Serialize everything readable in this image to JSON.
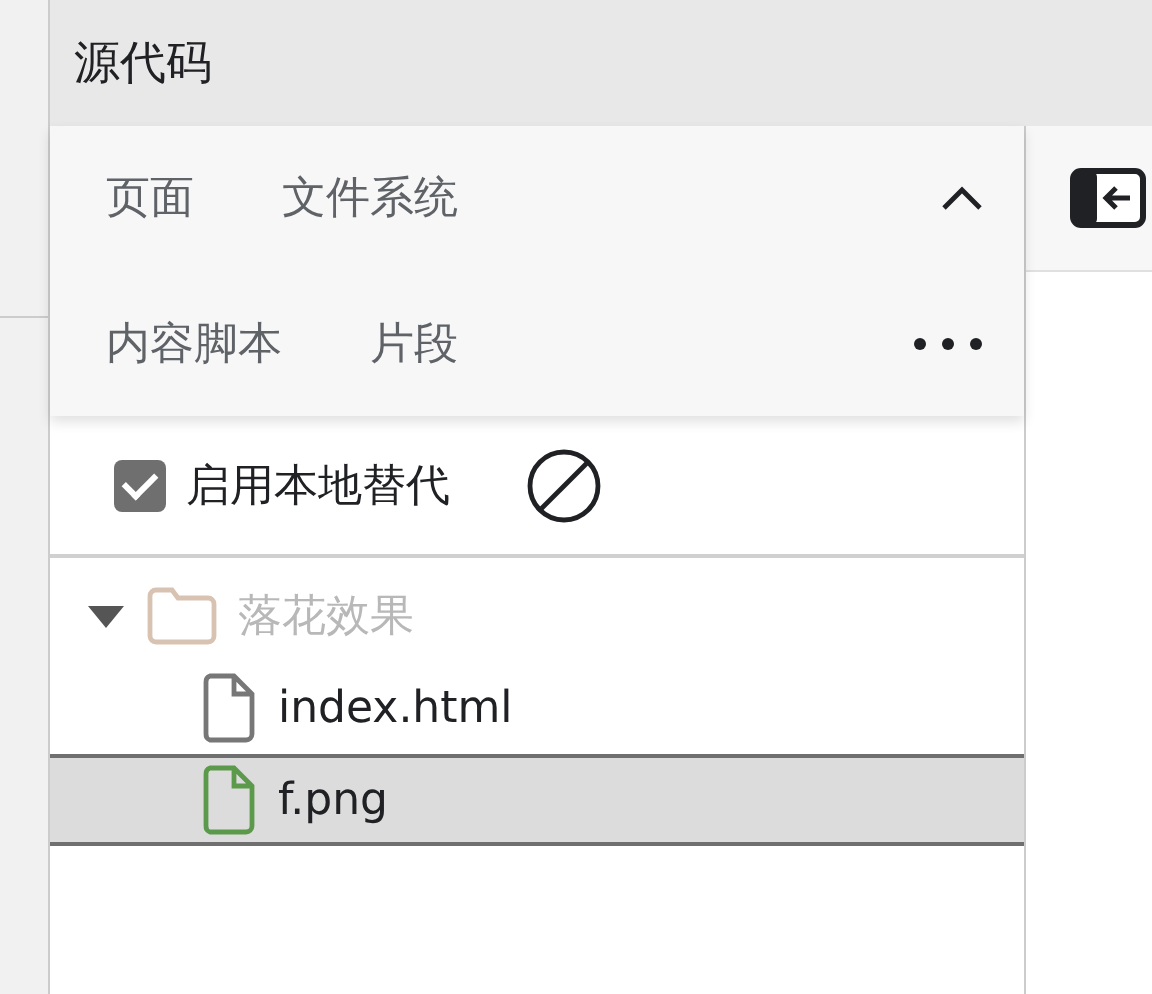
{
  "panel": {
    "title": "源代码"
  },
  "tabs": [
    {
      "label": "页面"
    },
    {
      "label": "文件系统"
    },
    {
      "label": "内容脚本"
    },
    {
      "label": "片段"
    }
  ],
  "overrides": {
    "label": "启用本地替代",
    "checked": true
  },
  "tree": [
    {
      "name": "落花效果",
      "kind": "folder",
      "expanded": true,
      "children": [
        {
          "name": "index.html",
          "kind": "file",
          "selected": false
        },
        {
          "name": "f.png",
          "kind": "image",
          "selected": true
        }
      ]
    }
  ]
}
